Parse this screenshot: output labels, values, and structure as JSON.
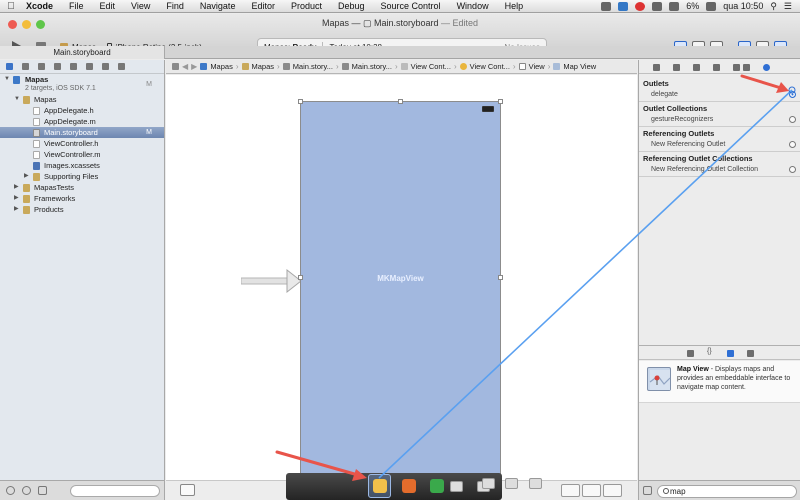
{
  "menubar": {
    "app": "Xcode",
    "items": [
      "File",
      "Edit",
      "View",
      "Find",
      "Navigate",
      "Editor",
      "Product",
      "Debug",
      "Source Control",
      "Window",
      "Help"
    ],
    "battery": "6%",
    "clock": "qua 10:50"
  },
  "window": {
    "title": "Mapas — ",
    "file": "Main.storyboard",
    "edited": " — Edited",
    "tab": "Main.storyboard"
  },
  "toolbar": {
    "scheme": "Mapas",
    "device": "iPhone Retina (3.5-inch)",
    "status_app": "Mapas:",
    "status": "Ready",
    "time": "Today at 10:38",
    "issues": "No Issues"
  },
  "navigator": {
    "project": "Mapas",
    "project_sub": "2 targets, iOS SDK 7.1",
    "project_badge": "M",
    "group": "Mapas",
    "files": [
      {
        "name": "AppDelegate.h",
        "badge": ""
      },
      {
        "name": "AppDelegate.m",
        "badge": ""
      },
      {
        "name": "Main.storyboard",
        "badge": "M"
      },
      {
        "name": "ViewController.h",
        "badge": ""
      },
      {
        "name": "ViewController.m",
        "badge": ""
      },
      {
        "name": "Images.xcassets",
        "badge": ""
      }
    ],
    "supporting": "Supporting Files",
    "groups": [
      "MapasTests",
      "Frameworks",
      "Products"
    ]
  },
  "jumpbar": {
    "crumbs": [
      "Mapas",
      "Mapas",
      "Main.story...",
      "Main.story...",
      "View Cont...",
      "View Cont...",
      "View",
      "Map View"
    ]
  },
  "canvas": {
    "map_label": "MKMapView"
  },
  "inspector": {
    "outlets_title": "Outlets",
    "outlet_delegate": "delegate",
    "collections_title": "Outlet Collections",
    "gesture": "gestureRecognizers",
    "referencing_title": "Referencing Outlets",
    "new_referencing": "New Referencing Outlet",
    "ref_collections_title": "Referencing Outlet Collections",
    "new_ref_collection": "New Referencing Outlet Collection"
  },
  "library": {
    "item_title": "Map View",
    "item_desc": " - Displays maps and provides an embeddable interface to navigate map content.",
    "search_value": "map"
  },
  "colors": {
    "map_fill": "#a2b8df",
    "connection_line": "#5aa0f0",
    "annotation_arrow": "#e8544a",
    "selection": "#6d86b0"
  }
}
